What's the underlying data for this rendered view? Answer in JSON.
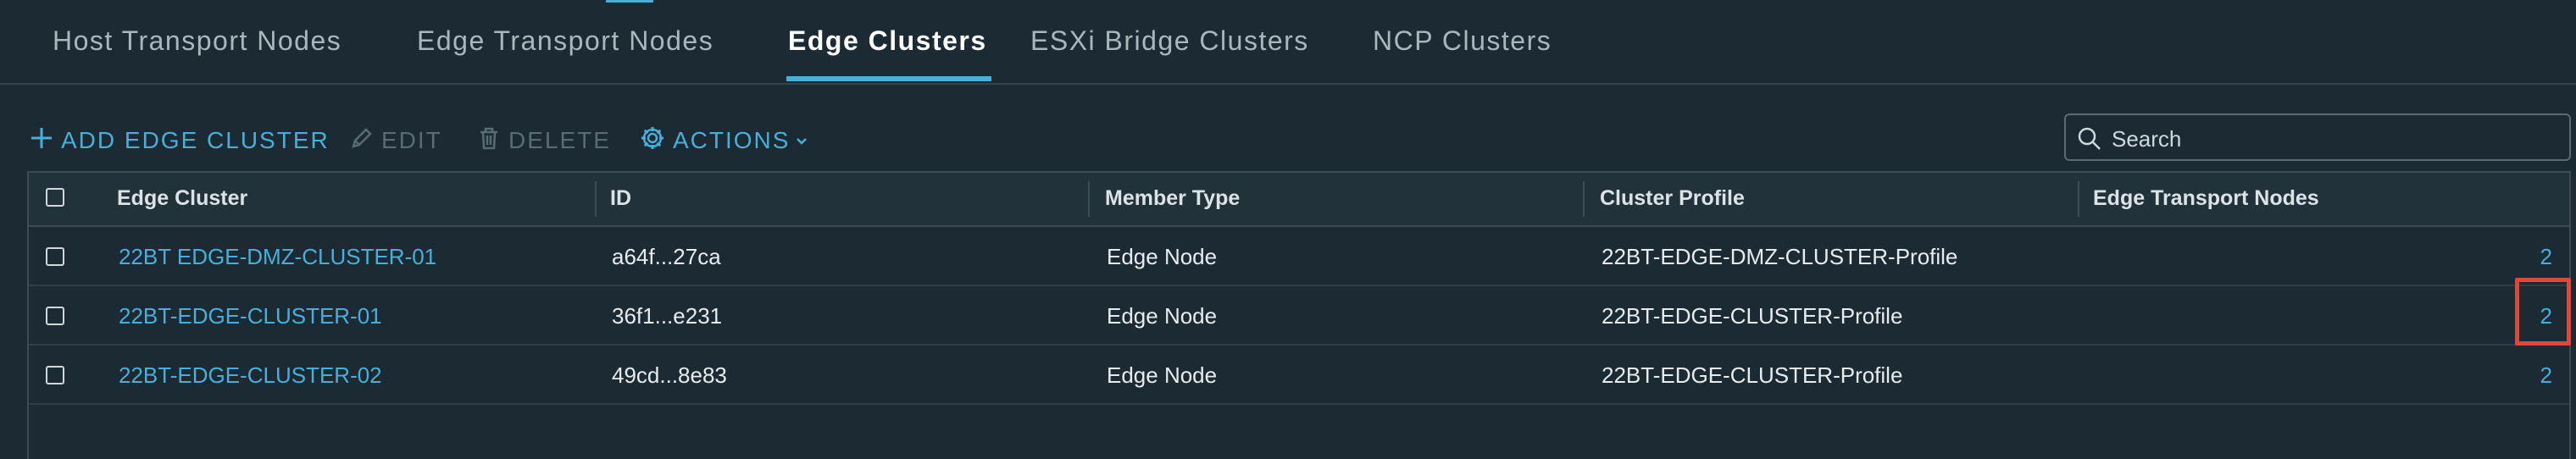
{
  "tabs": [
    {
      "label": "Host Transport Nodes",
      "active": false
    },
    {
      "label": "Edge Transport Nodes",
      "active": false
    },
    {
      "label": "Edge Clusters",
      "active": true
    },
    {
      "label": "ESXi Bridge Clusters",
      "active": false
    },
    {
      "label": "NCP Clusters",
      "active": false
    }
  ],
  "toolbar": {
    "add_label": "ADD EDGE CLUSTER",
    "edit_label": "EDIT",
    "delete_label": "DELETE",
    "actions_label": "ACTIONS"
  },
  "search": {
    "placeholder": "Search"
  },
  "table": {
    "columns": [
      "Edge Cluster",
      "ID",
      "Member Type",
      "Cluster Profile",
      "Edge Transport Nodes"
    ],
    "rows": [
      {
        "edge_cluster": "22BT EDGE-DMZ-CLUSTER-01",
        "id": "a64f...27ca",
        "member_type": "Edge Node",
        "cluster_profile": "22BT-EDGE-DMZ-CLUSTER-Profile",
        "edge_transport_nodes": "2"
      },
      {
        "edge_cluster": "22BT-EDGE-CLUSTER-01",
        "id": "36f1...e231",
        "member_type": "Edge Node",
        "cluster_profile": "22BT-EDGE-CLUSTER-Profile",
        "edge_transport_nodes": "2"
      },
      {
        "edge_cluster": "22BT-EDGE-CLUSTER-02",
        "id": "49cd...8e83",
        "member_type": "Edge Node",
        "cluster_profile": "22BT-EDGE-CLUSTER-Profile",
        "edge_transport_nodes": "2"
      }
    ]
  },
  "colors": {
    "accent": "#49afd9",
    "background": "#1b2a33",
    "highlight": "#e0473a"
  }
}
